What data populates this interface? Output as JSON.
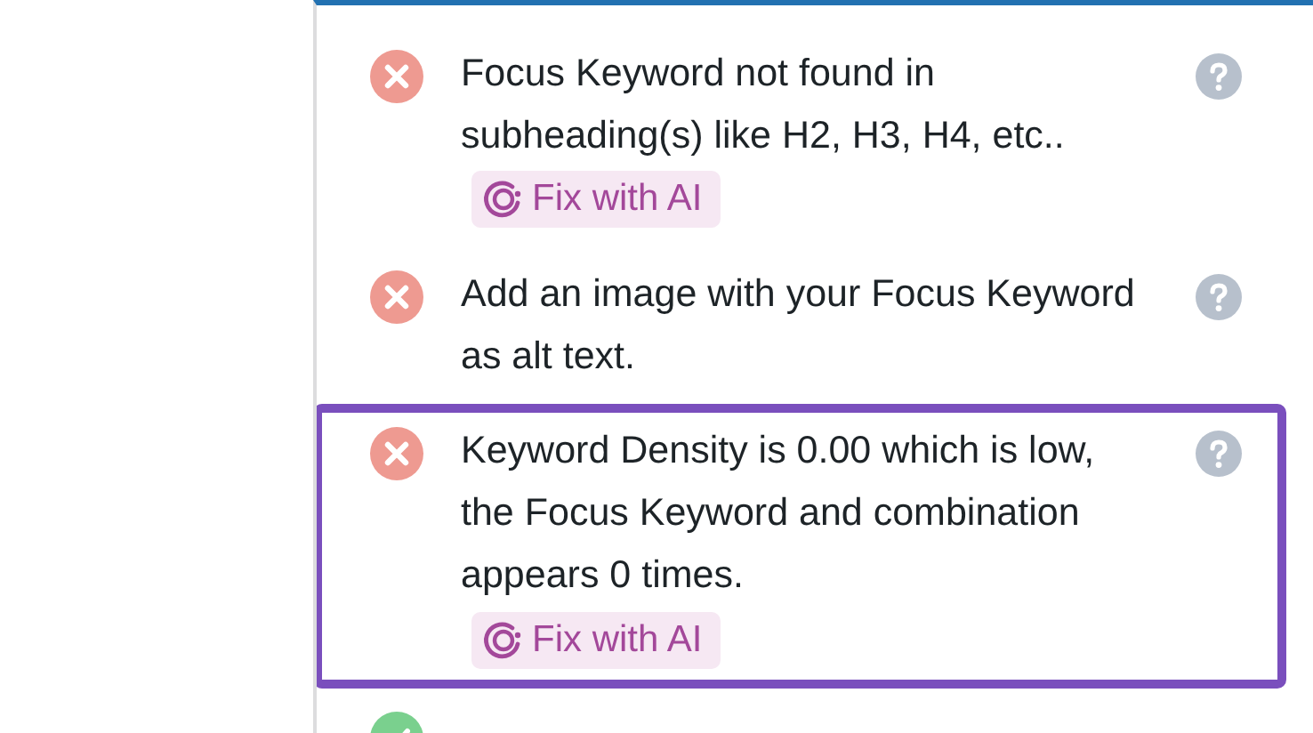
{
  "checks": [
    {
      "kind": "fail",
      "message": "Focus Keyword not found in subheading(s) like H2, H3, H4, etc..",
      "fix_button": "Fix with AI",
      "highlighted": false
    },
    {
      "kind": "fail",
      "message": "Add an image with your Focus Keyword as alt text.",
      "highlighted": false
    },
    {
      "kind": "fail",
      "message": "Keyword Density is 0.00 which is low, the Focus Keyword and combination appears 0 times.",
      "fix_button": "Fix with AI",
      "highlighted": true
    },
    {
      "kind": "pass",
      "highlighted": false
    }
  ]
}
